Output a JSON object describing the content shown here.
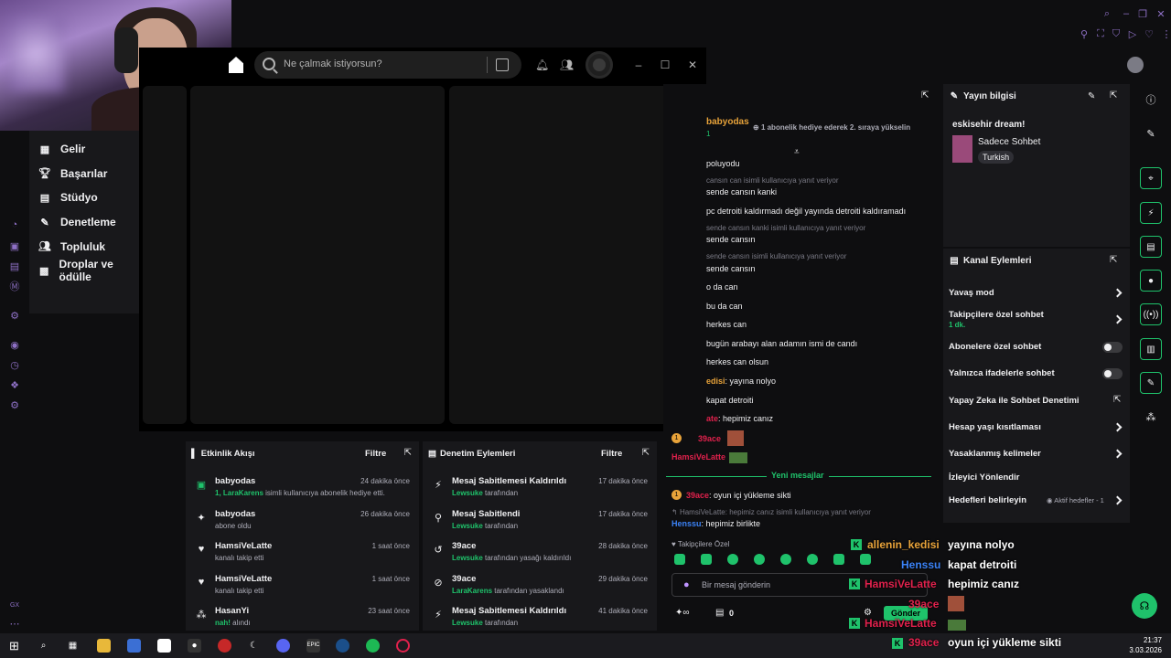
{
  "spotify": {
    "search_placeholder": "Ne çalmak istiyorsun?"
  },
  "creator_nav": {
    "items": [
      {
        "label": "Gelir"
      },
      {
        "label": "Başarılar"
      },
      {
        "label": "Stüdyo"
      },
      {
        "label": "Denetleme"
      },
      {
        "label": "Topluluk"
      },
      {
        "label": "Droplar ve ödülle"
      }
    ]
  },
  "chat": {
    "pinned_user": "babyodas",
    "pinned_level": "1",
    "pinned_text": "1 abonelik hediye ederek 2. sıraya yükselin",
    "lines": [
      {
        "t": "poluyodu"
      },
      {
        "t": "cansın can isimli kullanıcıya yanıt veriyor",
        "reply": true
      },
      {
        "t": "sende cansın kanki"
      },
      {
        "t": "pc detroiti kaldırmadı değil yayında detroiti kaldıramadı"
      },
      {
        "t": "sende cansın kanki isimli kullanıcıya yanıt veriyor",
        "reply": true
      },
      {
        "t": "sende cansın"
      },
      {
        "t": "sende cansın isimli kullanıcıya yanıt veriyor",
        "reply": true
      },
      {
        "t": "sende cansın"
      },
      {
        "t": "o da can"
      },
      {
        "t": "bu da can"
      },
      {
        "t": "herkes can"
      },
      {
        "t": "bugün arabayı alan adamın ismi de candı"
      },
      {
        "t": "herkes can olsun"
      }
    ],
    "line_kedisi_user": "edisi",
    "line_kedisi_text": "yayına nolyo",
    "line_kapat": "kapat detroiti",
    "line_hepimiz_user": "ate",
    "line_hepimiz_text": "hepimiz canız",
    "user_39ace": "39ace",
    "user_hamsi": "HamsiVeLatte",
    "new_messages": "Yeni mesajlar",
    "last_user": "39ace",
    "last_text": "oyun içi yükleme sikti",
    "reply_note": "HamsiVeLatte: hepimiz canız isimli kullanıcıya yanıt veriyor",
    "henssu_user": "Henssu",
    "henssu_text": "hepimiz birlikte",
    "followers_only": "Takipçilere Özel",
    "input_placeholder": "Bir mesaj gönderin",
    "points": "0",
    "send": "Gönder"
  },
  "stream_info": {
    "title": "Yayın bilgisi",
    "stream_title": "eskisehir dream!",
    "category": "Sadece Sohbet",
    "tag": "Turkish"
  },
  "channel_actions": {
    "title": "Kanal Eylemleri",
    "slow_mode": "Yavaş mod",
    "followers_chat": "Takipçilere özel sohbet",
    "followers_time": "1 dk.",
    "subs_chat": "Abonelere özel sohbet",
    "emote_chat": "Yalnızca ifadelerle sohbet",
    "ai_mod": "Yapay Zeka ile Sohbet Denetimi",
    "age_limit": "Hesap yaşı kısıtlaması",
    "banned_words": "Yasaklanmış kelimeler",
    "redirect": "İzleyici Yönlendir",
    "goals": "Hedefleri belirleyin",
    "active_goals": "Aktif hedefler - 1"
  },
  "activity": {
    "title": "Etkinlik Akışı",
    "filter": "Filtre",
    "events": [
      {
        "name": "babyodas",
        "time": "24 dakika önce",
        "sub_prefix": "1, LaraKarens",
        "sub": " isimli kullanıcıya abonelik hediye etti."
      },
      {
        "name": "babyodas",
        "time": "26 dakika önce",
        "sub_prefix": "",
        "sub": "abone oldu"
      },
      {
        "name": "HamsiVeLatte",
        "time": "1 saat önce",
        "sub_prefix": "",
        "sub": "kanalı takip etti"
      },
      {
        "name": "HamsiVeLatte",
        "time": "1 saat önce",
        "sub_prefix": "",
        "sub": "kanalı takip etti"
      },
      {
        "name": "HasanYi",
        "time": "23 saat önce",
        "sub_prefix": "nah!",
        "sub": " alındı"
      }
    ]
  },
  "mod": {
    "title": "Denetim Eylemleri",
    "filter": "Filtre",
    "events": [
      {
        "name": "Mesaj Sabitlemesi Kaldırıldı",
        "time": "17 dakika önce",
        "by": "Lewsuke",
        "sub": " tarafından"
      },
      {
        "name": "Mesaj Sabitlendi",
        "time": "17 dakika önce",
        "by": "Lewsuke",
        "sub": " tarafından"
      },
      {
        "name": "39ace",
        "time": "28 dakika önce",
        "by": "Lewsuke",
        "sub": " tarafından yasağı kaldırıldı"
      },
      {
        "name": "39ace",
        "time": "29 dakika önce",
        "by": "LaraKarens",
        "sub": " tarafından yasaklandı"
      },
      {
        "name": "Mesaj Sabitlemesi Kaldırıldı",
        "time": "41 dakika önce",
        "by": "Lewsuke",
        "sub": " tarafından"
      }
    ]
  },
  "overlay": {
    "lines": [
      {
        "user": "allenin_kedisi",
        "text": "yayına nolyo",
        "color": "#e8a33a"
      },
      {
        "user": "Henssu",
        "text": "kapat detroiti",
        "color": "#3b82f6"
      },
      {
        "user": "HamsiVeLatte",
        "text": "hepimiz canız",
        "color": "#e0214c"
      },
      {
        "user": "39ace",
        "text": "",
        "color": "#e0214c"
      },
      {
        "user": "HamsiVeLatte",
        "text": "",
        "color": "#e0214c"
      },
      {
        "user": "39ace",
        "text": "oyun içi yükleme sikti",
        "color": "#e0214c"
      }
    ]
  },
  "taskbar": {
    "time": "21:37",
    "date": "3.03.2026"
  },
  "misc": {
    "gx": "GX"
  }
}
